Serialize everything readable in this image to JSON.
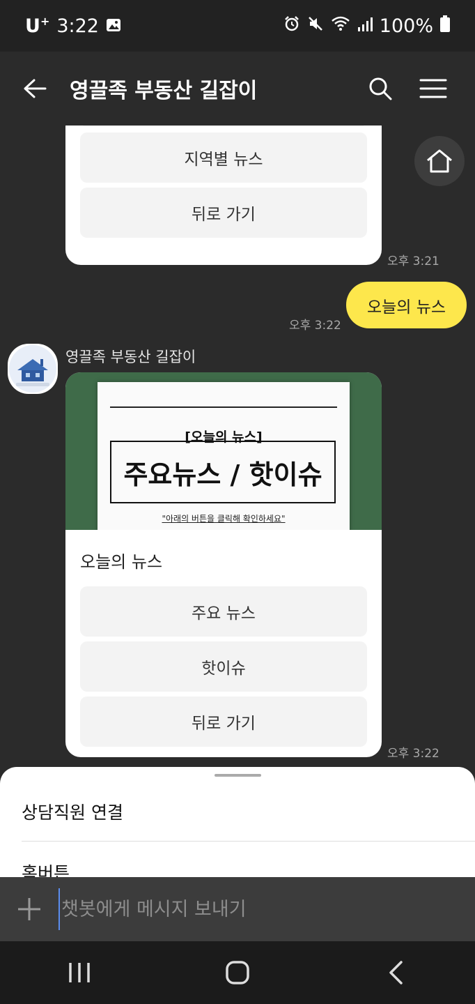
{
  "status_bar": {
    "carrier": "U",
    "carrier_sup": "+",
    "time": "3:22",
    "battery": "100%"
  },
  "header": {
    "title": "영끌족 부동산 길잡이"
  },
  "chat": {
    "previous_card": {
      "buttons": [
        "지역별 뉴스",
        "뒤로 가기"
      ],
      "time": "오후 3:21"
    },
    "my_message": {
      "text": "오늘의 뉴스",
      "time": "오후 3:22"
    },
    "bot_message": {
      "sender": "영끌족 부동산 길잡이",
      "thumbnail": {
        "tag": "[오늘의 뉴스]",
        "headline": "주요뉴스 / 핫이슈",
        "subtitle": "\"아래의 버튼을 클릭해 확인하세요\""
      },
      "description": "오늘의 뉴스",
      "buttons": [
        "주요 뉴스",
        "핫이슈",
        "뒤로 가기"
      ],
      "time": "오후 3:22"
    }
  },
  "quick_replies": [
    "상담직원 연결",
    "홈버튼"
  ],
  "input": {
    "placeholder": "챗봇에게 메시지 보내기"
  },
  "icons": {
    "back": "arrow-left-icon",
    "search": "search-icon",
    "menu": "hamburger-menu-icon",
    "home": "home-icon",
    "plus": "plus-icon"
  },
  "colors": {
    "my_bubble": "#fde74c",
    "background": "#2b2b2b",
    "thumbnail_bg": "#3f6b49"
  }
}
